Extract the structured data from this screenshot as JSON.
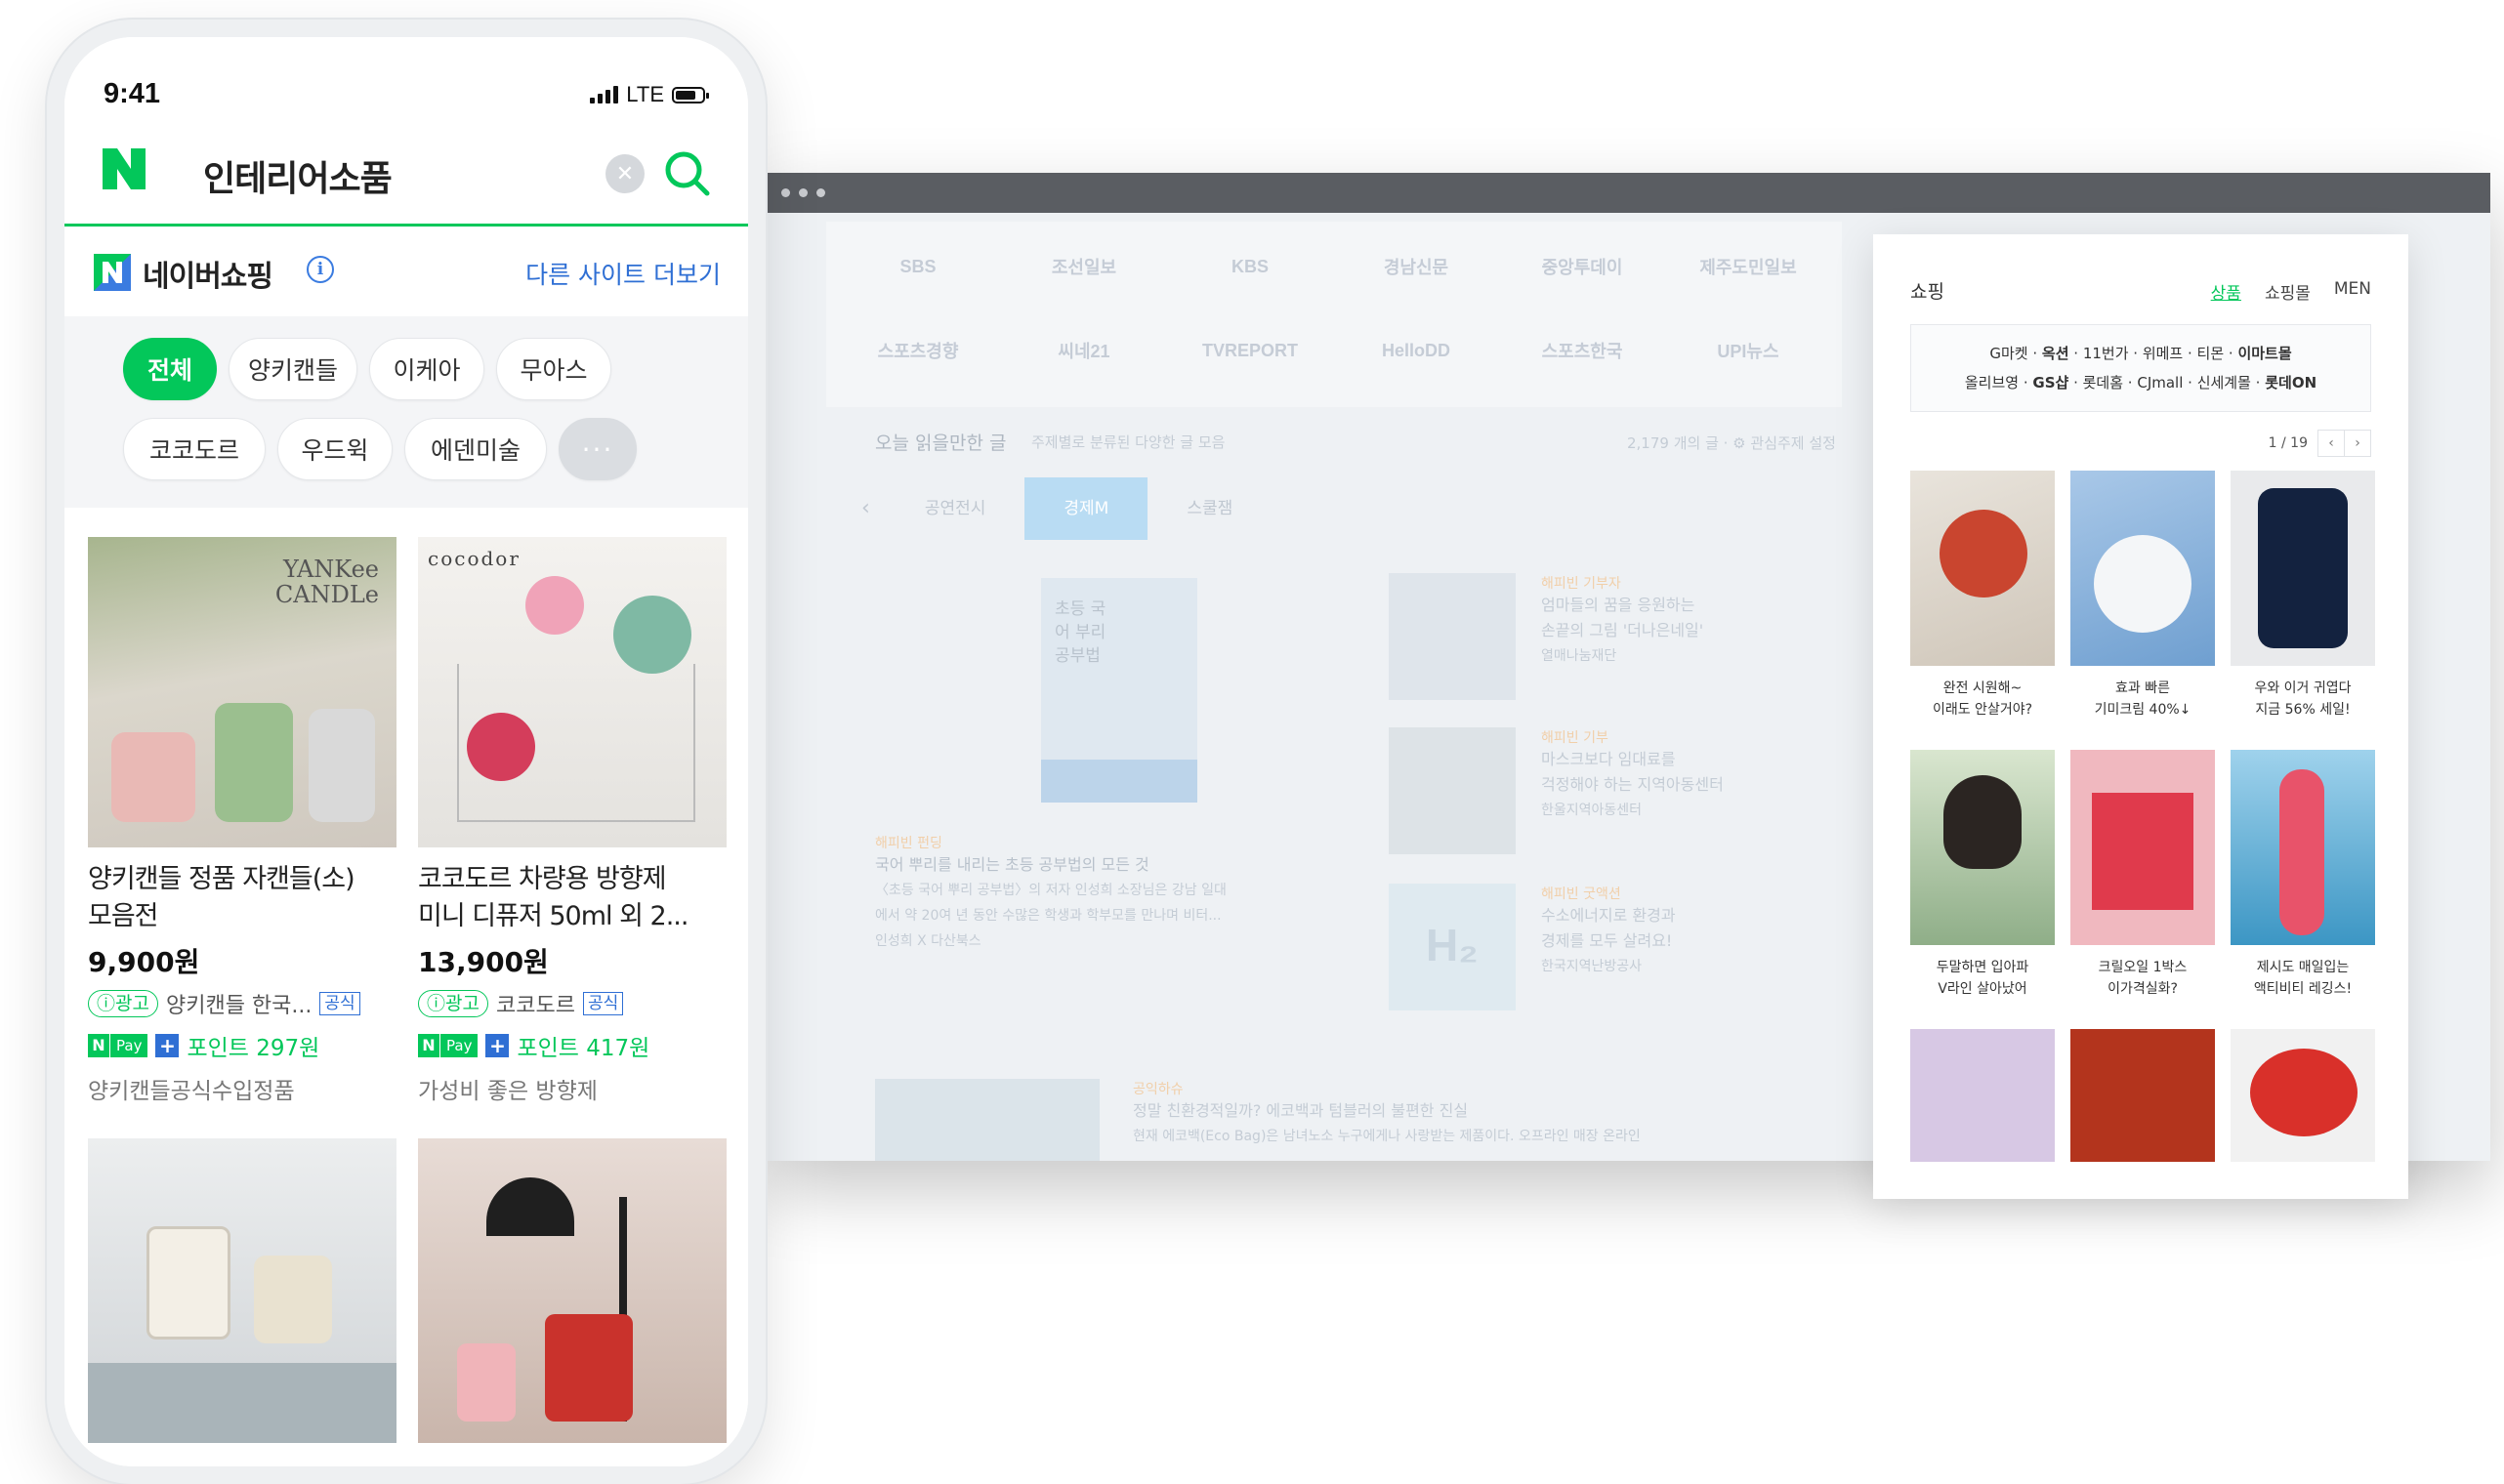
{
  "phone": {
    "status": {
      "time": "9:41",
      "network": "LTE"
    },
    "search": {
      "query": "인테리어소품",
      "clear_icon": "x-circle-icon",
      "search_icon": "search-icon"
    },
    "shopping": {
      "title": "네이버쇼핑",
      "info_icon": "info-icon",
      "more_sites": "다른 사이트 더보기"
    },
    "filters": [
      {
        "label": "전체",
        "active": true
      },
      {
        "label": "양키캔들"
      },
      {
        "label": "이케아"
      },
      {
        "label": "무아스"
      },
      {
        "label": "코코도르"
      },
      {
        "label": "우드윅"
      },
      {
        "label": "에덴미술"
      },
      {
        "label": "···"
      }
    ],
    "products": [
      {
        "image_brand": "YANKee CANDLe",
        "title_line1": "양키캔들 정품 자캔들(소)",
        "title_line2": "모음전",
        "price": "9,900원",
        "ad": "ⓘ광고",
        "seller": "양키캔들 한국...",
        "official": "공식",
        "npay_n": "N",
        "npay_pay": "Pay",
        "plus": "+",
        "point": "포인트 297원",
        "desc": "양키캔들공식수입정품"
      },
      {
        "image_brand": "cocodor",
        "title_line1": "코코도르 차량용 방향제",
        "title_line2": "미니 디퓨저 50ml 외 2...",
        "price": "13,900원",
        "ad": "ⓘ광고",
        "seller": "코코도르",
        "official": "공식",
        "npay_n": "N",
        "npay_pay": "Pay",
        "plus": "+",
        "point": "포인트 417원",
        "desc": "가성비 좋은 방향제"
      }
    ]
  },
  "browser": {
    "publishers": [
      "SBS",
      "조선일보",
      "KBS",
      "경남신문",
      "중앙투데이",
      "제주도민일보",
      "스포츠경향",
      "씨네21",
      "TVREPORT",
      "HelloDD",
      "스포츠한국",
      "UPI뉴스"
    ],
    "section": {
      "title": "오늘 읽을만한 글",
      "subtitle": "주제별로 분류된 다양한 글 모음",
      "count": "2,179 개의 글 · ⚙ 관심주제 설정"
    },
    "tabs": [
      {
        "label": "공연전시"
      },
      {
        "label": "경제M",
        "active": true
      },
      {
        "label": "스쿨잼"
      }
    ],
    "book": {
      "title": "초등 국어 부리 공부법"
    },
    "articles": [
      {
        "tag": "해피빈 펀딩",
        "title": "국어 뿌리를 내리는 초등 공부법의 모든 것",
        "body1": "〈초등 국어 뿌리 공부법〉의 저자 인성희 소장님은 강남 일대",
        "body2": "에서 약 20여 년 동안 수많은 학생과 학부모를 만나며 비터...",
        "source": "인성희 X 다산북스"
      },
      {
        "tag": "해피빈 기부자",
        "title": "엄마들의 꿈을 응원하는",
        "title2": "손끝의 그림 '더나은네일'",
        "source": "열매나눔재단"
      },
      {
        "tag": "해피빈 기부",
        "title": "마스크보다 임대료를",
        "title2": "걱정해야 하는 지역아동센터",
        "source": "한울지역아동센터"
      },
      {
        "tag": "해피빈 굿액션",
        "title": "수소에너지로 환경과",
        "title2": "경제를 모두 살려요!",
        "source": "한국지역난방공사"
      },
      {
        "tag": "공익하슈",
        "title": "정말 친환경적일까? 에코백과 텀블러의 불편한 진실",
        "body1": "현재 에코백(Eco Bag)은 남녀노소 누구에게나 사랑받는 제품이다. 오프라인 매장 온라인"
      }
    ]
  },
  "shop_panel": {
    "title": "쇼핑",
    "tabs": [
      {
        "label": "상품",
        "active": true
      },
      {
        "label": "쇼핑몰"
      },
      {
        "label": "MEN"
      }
    ],
    "sites_line1": [
      "G마켓",
      "옥션",
      "11번가",
      "위메프",
      "티몬",
      "이마트몰"
    ],
    "sites_line2": [
      "올리브영",
      "GS샵",
      "롯데홈",
      "CJmall",
      "신세계몰",
      "롯데ON"
    ],
    "pager": {
      "text": "1 / 19",
      "prev": "‹",
      "next": "›"
    },
    "products": [
      {
        "line1": "완전 시원해~",
        "line2": "이래도 안살거야?"
      },
      {
        "line1": "효과 빠른",
        "line2": "기미크림 40%↓"
      },
      {
        "line1": "우와 이거 귀엽다",
        "line2": "지금 56% 세일!"
      },
      {
        "line1": "두말하면 입아파",
        "line2": "V라인 살아났어"
      },
      {
        "line1": "크릴오일 1박스",
        "line2": "이가격실화?"
      },
      {
        "line1": "제시도 매일입는",
        "line2": "액티비티 레깅스!"
      }
    ]
  }
}
